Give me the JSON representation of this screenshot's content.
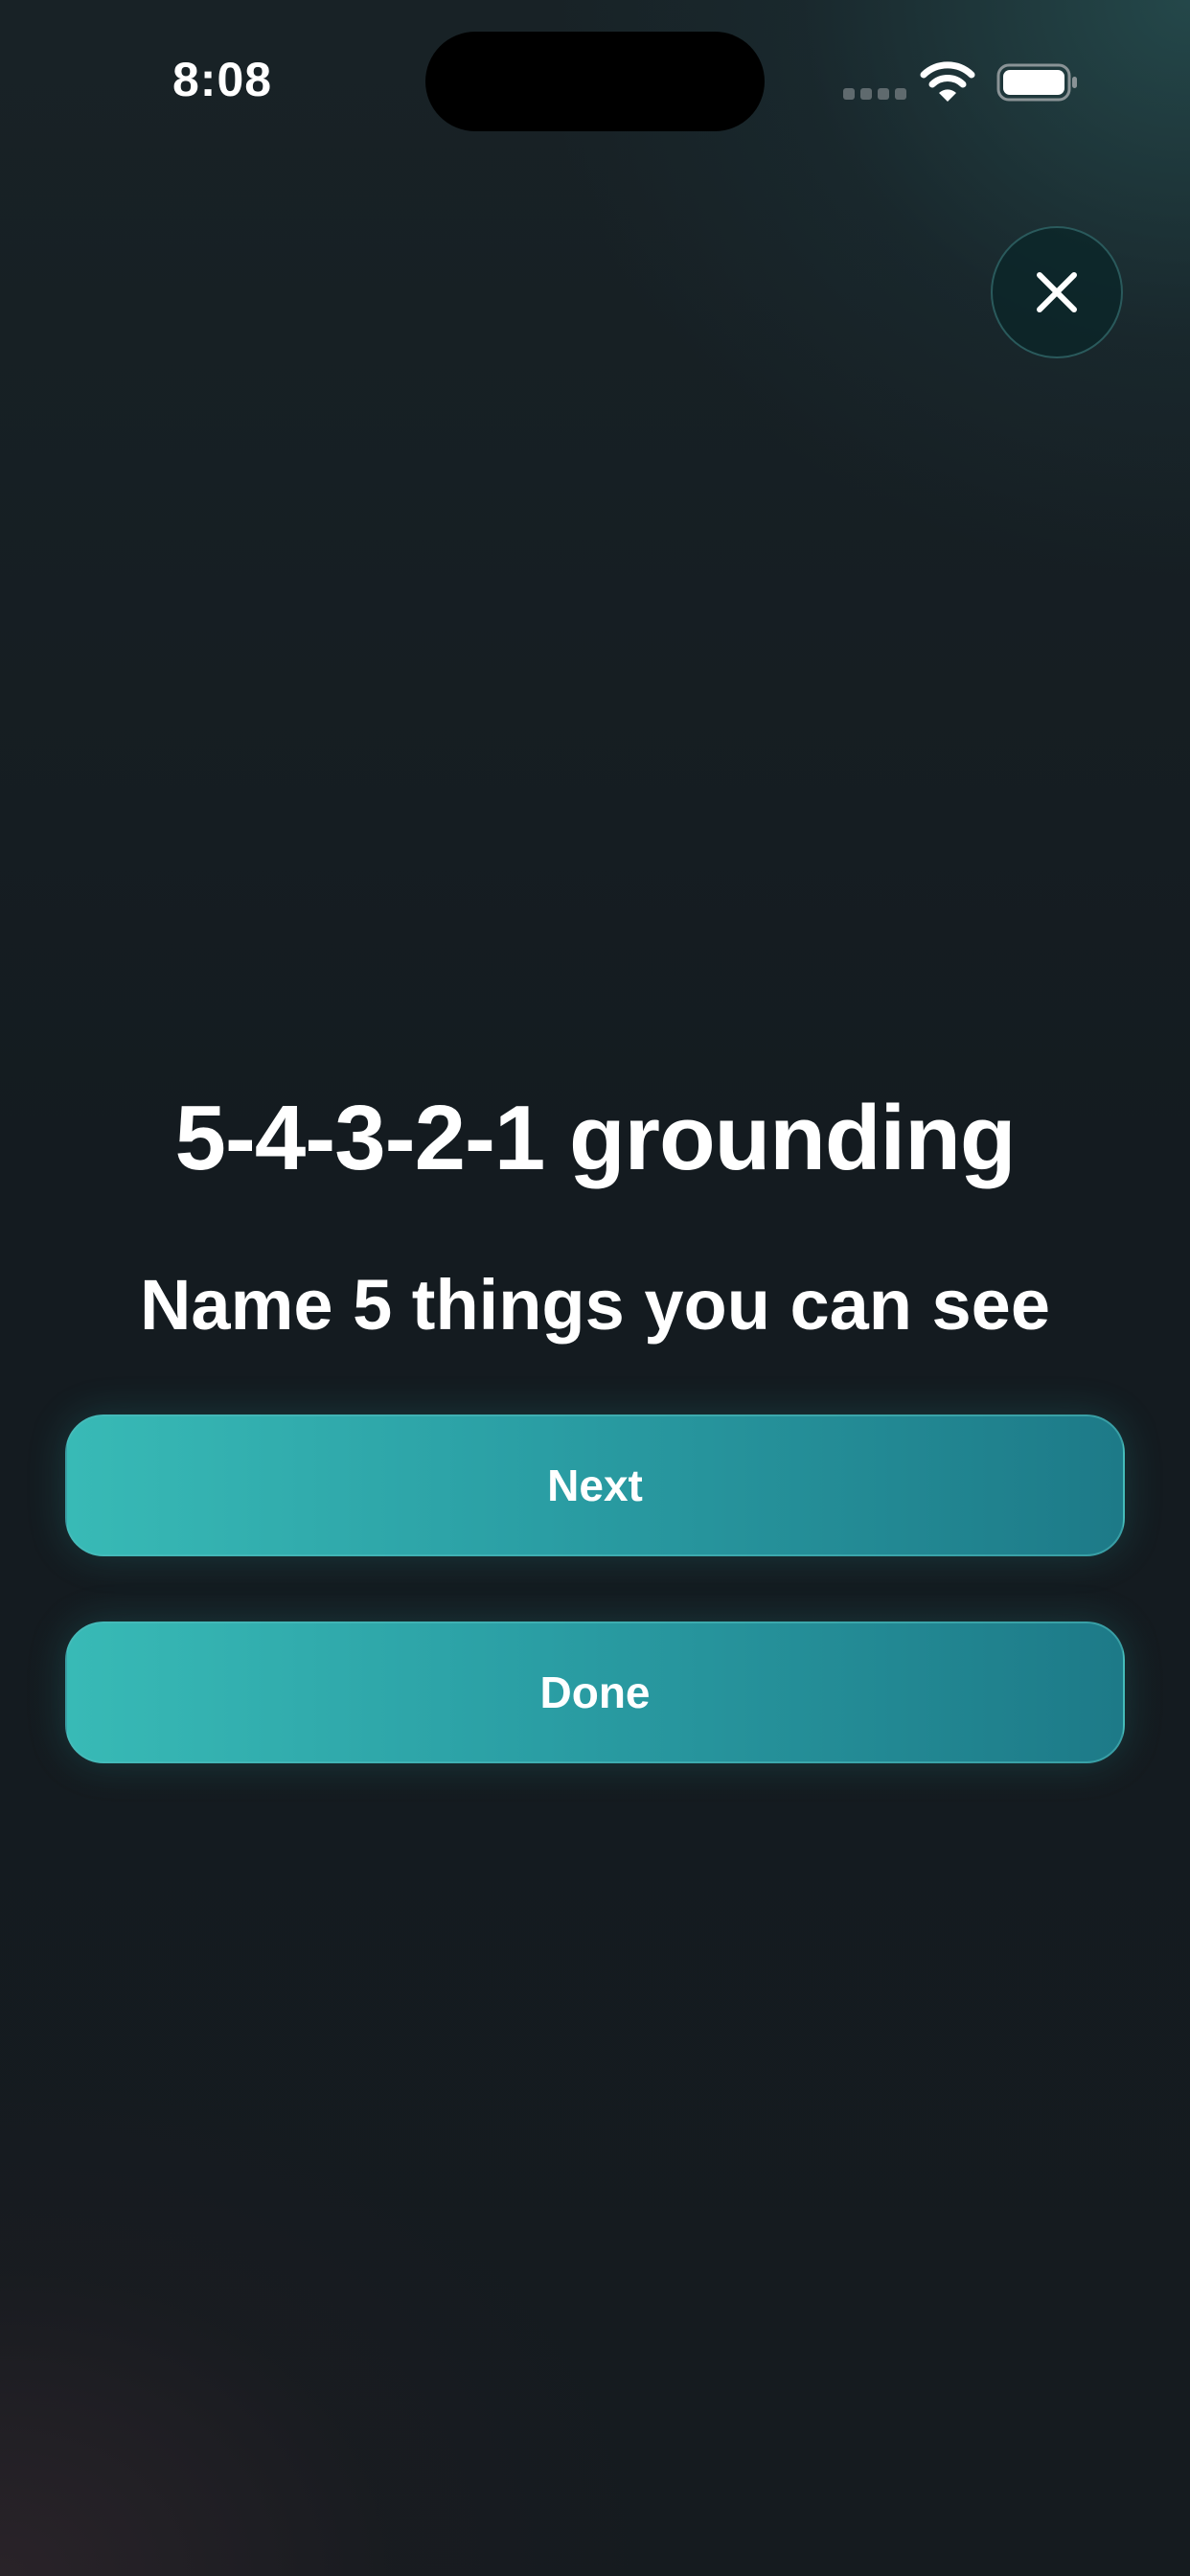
{
  "status_bar": {
    "time": "8:08"
  },
  "icons": {
    "close": "close-icon",
    "wifi": "wifi-icon",
    "battery": "battery-icon",
    "cellular": "cellular-signal-icon"
  },
  "exercise": {
    "title": "5-4-3-2-1 grounding",
    "prompt": "Name 5 things you can see"
  },
  "actions": {
    "next_label": "Next",
    "done_label": "Done"
  },
  "colors": {
    "accent_start": "#38bab6",
    "accent_end": "#1d7a88",
    "background": "#151b1f"
  }
}
